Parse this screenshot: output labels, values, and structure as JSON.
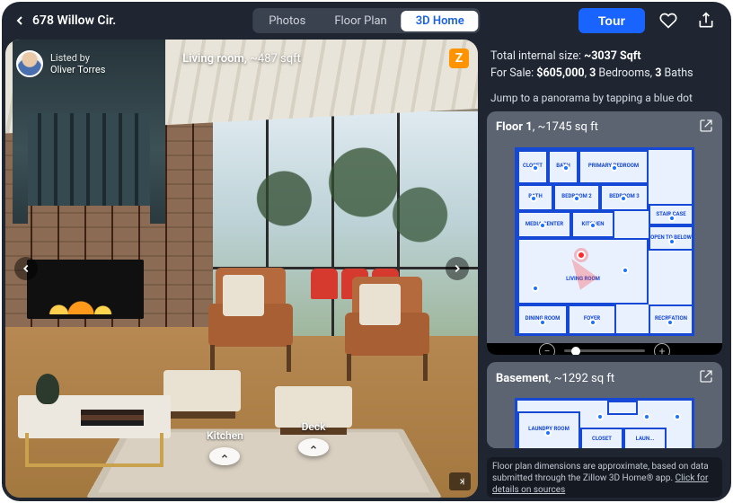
{
  "header": {
    "address": "678 Willow Cir.",
    "tabs": {
      "photos": "Photos",
      "floorplan": "Floor Plan",
      "home3d": "3D Home"
    },
    "tour_label": "Tour"
  },
  "photo": {
    "listed_by_label": "Listed by",
    "agent_name": "Oliver Torres",
    "room_label": "Living room",
    "room_sqft": "~487 sqft",
    "hotspots": {
      "kitchen": "Kitchen",
      "deck": "Deck"
    },
    "brand_letter": "Z"
  },
  "stats": {
    "size_label": "Total internal size:",
    "size_value": "~3037 Sqft",
    "sale_label": "For Sale:",
    "price": "$605,000",
    "beds_n": "3",
    "beds_label": "Bedrooms,",
    "baths_n": "3",
    "baths_label": "Baths"
  },
  "jump_hint": "Jump to a panorama by tapping a blue dot",
  "floors": {
    "f1": {
      "name": "Floor 1",
      "area": "~1745 sq ft",
      "rooms": {
        "closet": "CLOSET",
        "bath": "BATH",
        "primary": "PRIMARY BEDROOM",
        "bedroom2": "BEDROOM 2",
        "bedroom3": "BEDROOM 3",
        "kitchen": "KITCHEN",
        "mediacenter": "MEDIA CENTER",
        "staircase": "STAIR CASE",
        "opentobelow": "OPEN TO BELOW",
        "living": "LIVING ROOM",
        "dining": "DINING ROOM",
        "foyer": "FOYER",
        "rec": "RECREATION"
      }
    },
    "basement": {
      "name": "Basement",
      "area": "~1292 sq ft",
      "rooms": {
        "laundry": "LAUNDRY ROOM",
        "closet": "CLOSET",
        "laun2": "LAUN..."
      }
    }
  },
  "footer": {
    "text": "Floor plan dimensions are approximate, based on data submitted through the Zillow 3D Home® app.",
    "link": "Click for details on sources"
  }
}
